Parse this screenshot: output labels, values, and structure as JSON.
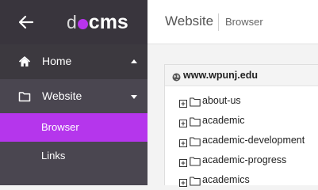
{
  "sidebar": {
    "logo": {
      "prefix": "d",
      "suffix": "cms",
      "dot_color": "#b734ec"
    },
    "nav": [
      {
        "label": "Home",
        "icon": "home-icon",
        "state": "collapsed"
      },
      {
        "label": "Website",
        "icon": "folder-icon",
        "state": "expanded"
      }
    ],
    "subnav": [
      {
        "label": "Browser",
        "active": true
      },
      {
        "label": "Links",
        "active": false
      }
    ]
  },
  "header": {
    "title": "Website",
    "subtitle": "Browser"
  },
  "tree": {
    "host": "www.wpunj.edu",
    "items": [
      {
        "label": "about-us"
      },
      {
        "label": "academic"
      },
      {
        "label": "academic-development"
      },
      {
        "label": "academic-progress"
      },
      {
        "label": "academics"
      }
    ]
  },
  "colors": {
    "accent": "#b536ec",
    "sidebar_bg": "#3c393f",
    "sidebar_sub_bg": "#4a4650"
  }
}
